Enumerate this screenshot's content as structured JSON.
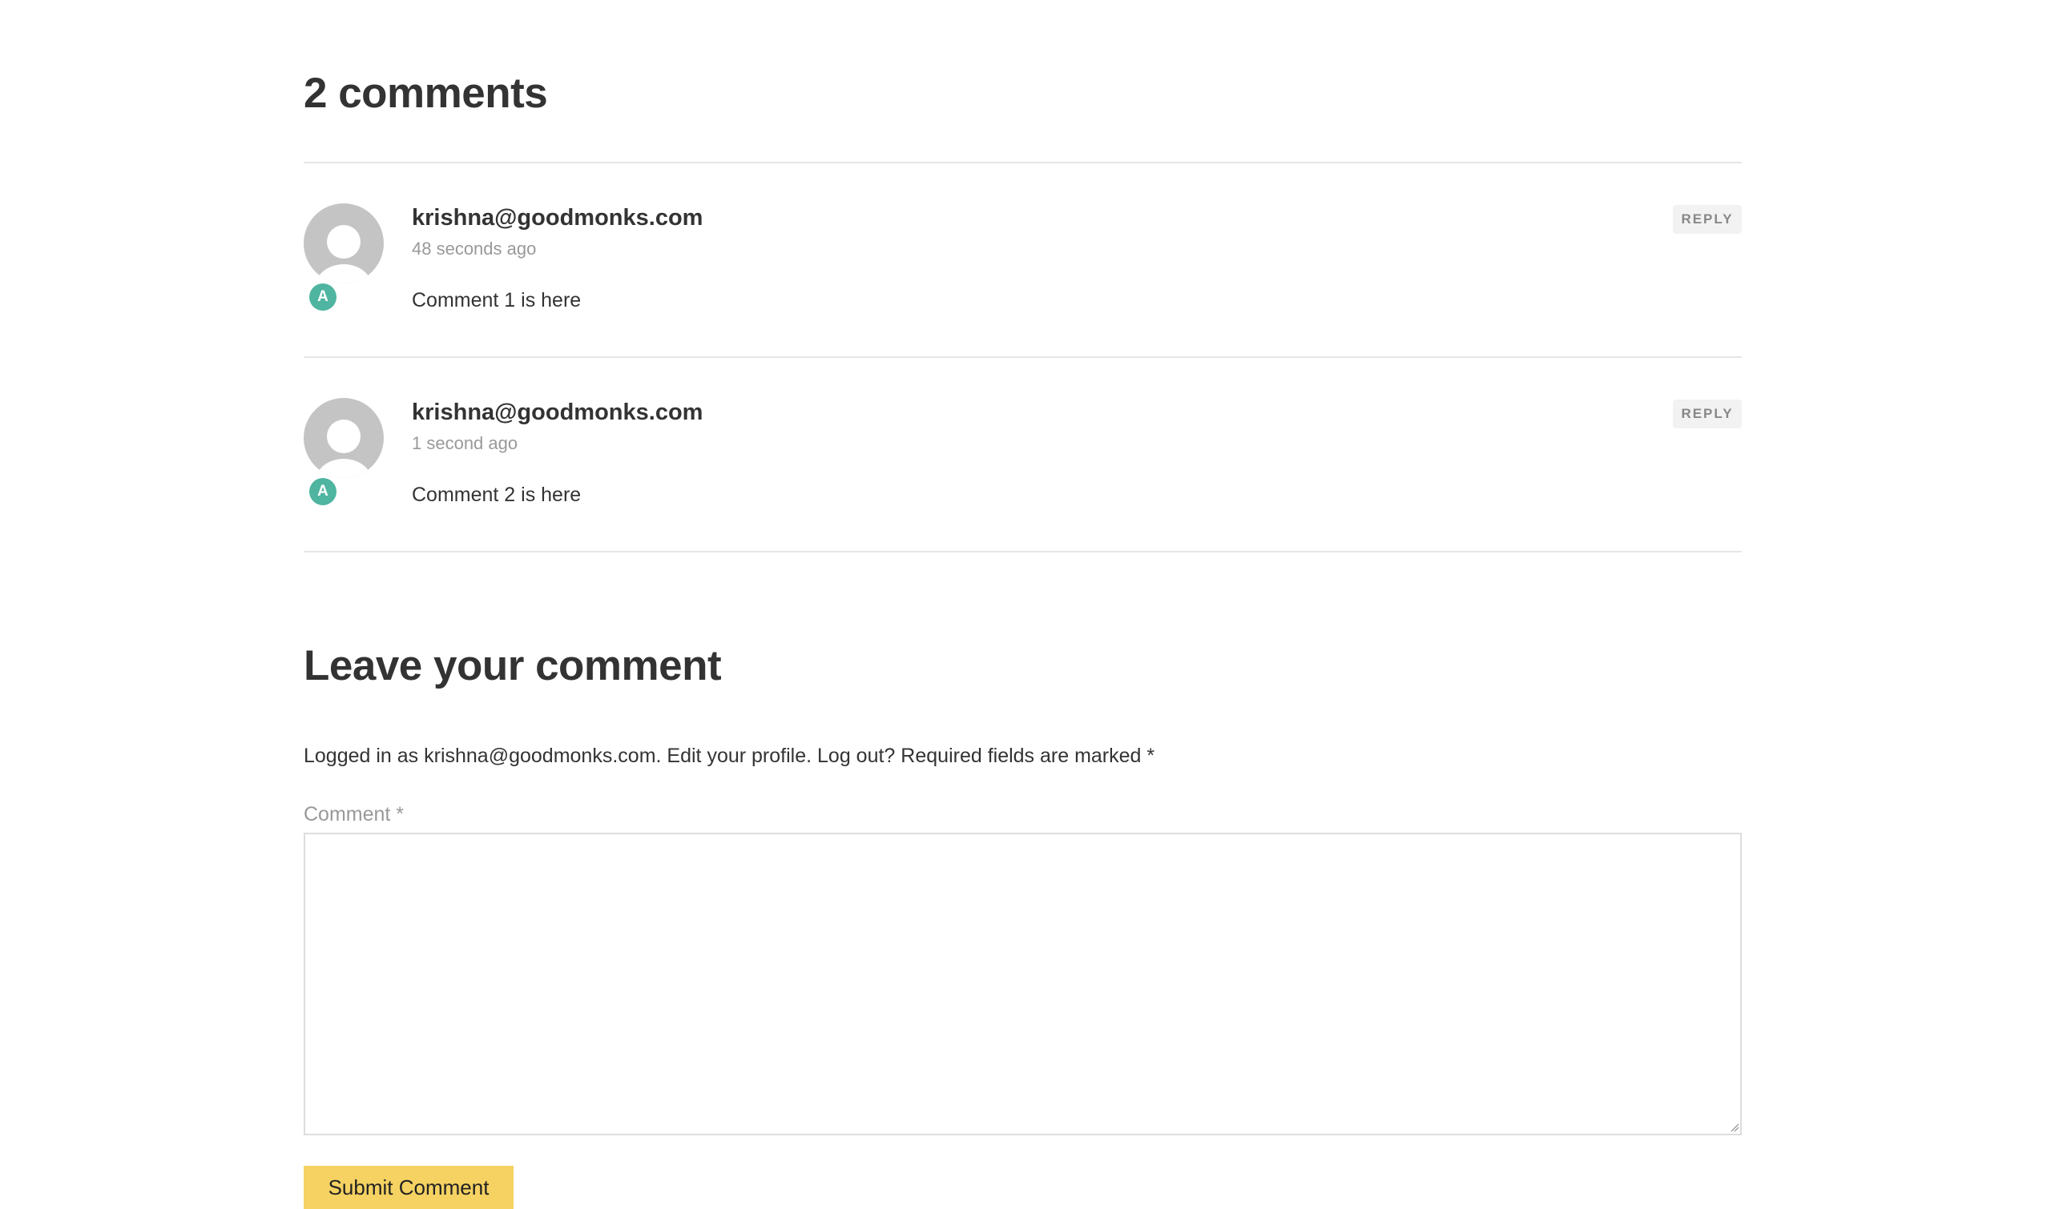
{
  "comments_section": {
    "title": "2 comments",
    "items": [
      {
        "author": "krishna@goodmonks.com",
        "time": "48 seconds ago",
        "text": "Comment 1 is here",
        "badge": "A",
        "reply_label": "REPLY"
      },
      {
        "author": "krishna@goodmonks.com",
        "time": "1 second ago",
        "text": "Comment 2 is here",
        "badge": "A",
        "reply_label": "REPLY"
      }
    ]
  },
  "comment_form": {
    "title": "Leave your comment",
    "logged_in_prefix": "Logged in as krishna@goodmonks.com.",
    "edit_profile": "Edit your profile.",
    "log_out": "Log out?",
    "required_note": "Required fields are marked",
    "required_marker": "*",
    "comment_label": "Comment *",
    "comment_value": "",
    "submit_label": "Submit Comment"
  },
  "colors": {
    "badge": "#4fb5a1",
    "submit_button": "#f5d262",
    "avatar": "#c4c4c4"
  }
}
